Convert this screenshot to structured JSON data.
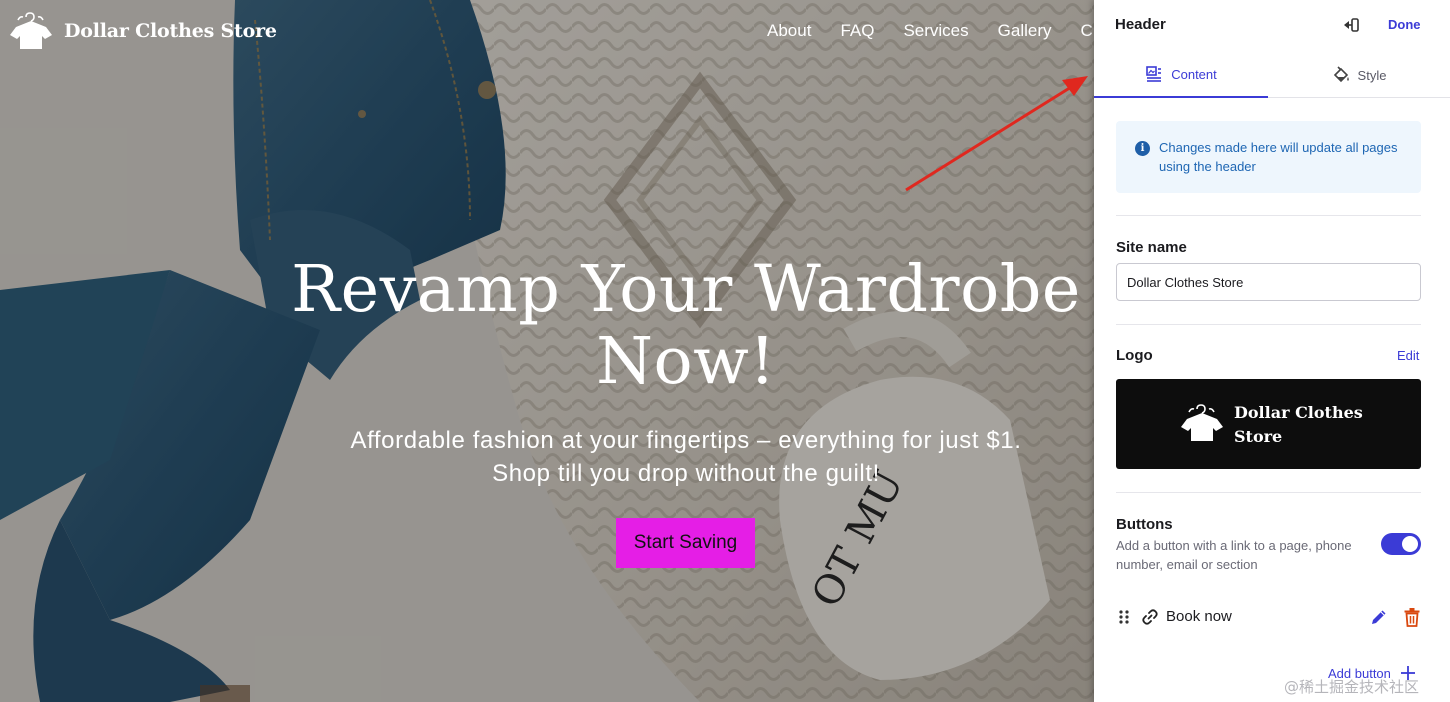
{
  "site": {
    "name": "Dollar Clothes Store",
    "nav": [
      "About",
      "FAQ",
      "Services",
      "Gallery",
      "C"
    ],
    "hero_title": "Revamp Your Wardrobe Now!",
    "hero_subtitle": "Affordable fashion at your fingertips – everything for just $1. Shop till you drop without the guilt!",
    "cta_label": "Start Saving",
    "cta_color": "#e51ee6",
    "logo_icon": "tshirt-hanger-icon"
  },
  "panel": {
    "title": "Header",
    "done_label": "Done",
    "tabs": [
      {
        "label": "Content",
        "icon": "content-icon",
        "active": true
      },
      {
        "label": "Style",
        "icon": "paint-bucket-icon",
        "active": false
      }
    ],
    "notice": "Changes made here will update all pages using the header",
    "site_name_label": "Site name",
    "site_name_value": "Dollar Clothes Store",
    "logo_label": "Logo",
    "logo_edit_label": "Edit",
    "logo_preview_text": "Dollar Clothes Store",
    "buttons_label": "Buttons",
    "buttons_description": "Add a button with a link to a page, phone number, email or section",
    "buttons_enabled": true,
    "button_items": [
      {
        "label": "Book now"
      }
    ],
    "add_button_label": "Add button",
    "accent_color": "#3b3bd6"
  },
  "watermark": "@稀土掘金技术社区"
}
